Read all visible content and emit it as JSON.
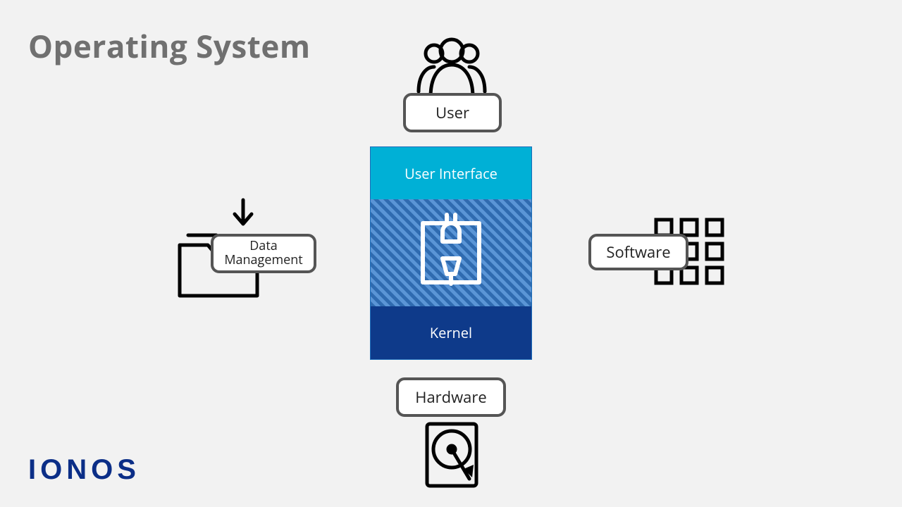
{
  "title": "Operating System",
  "logo": "IONOS",
  "labels": {
    "user": "User",
    "user_interface": "User Interface",
    "kernel": "Kernel",
    "hardware": "Hardware",
    "software": "Software",
    "data_management": "Data\nManagement"
  },
  "colors": {
    "title": "#707070",
    "logo": "#0b2e87",
    "ui_layer": "#00b0d6",
    "mid_layer": "#3a7fc8",
    "kernel_layer": "#0e3a8a",
    "pill_border": "#555555"
  }
}
